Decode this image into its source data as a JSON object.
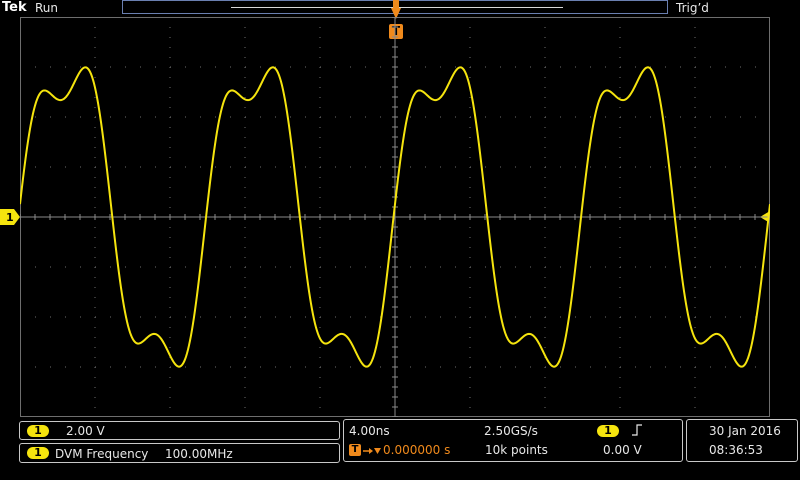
{
  "header": {
    "brand": "Tek",
    "acquisition_state": "Run",
    "trigger_state": "Trig’d"
  },
  "markers": {
    "trigger_marker": "T",
    "channel_marker": "1"
  },
  "channel1": {
    "label": "1",
    "vertical_scale": "2.00 V",
    "color": "#f5e40e"
  },
  "dvm": {
    "channel": "1",
    "label": "DVM Frequency",
    "value": "100.00MHz"
  },
  "horizontal": {
    "time_per_div": "4.00ns",
    "sample_rate": "2.50GS/s",
    "trigger_badge": "T",
    "delay": "0.000000 s",
    "record_length": "10k points"
  },
  "trigger": {
    "source": "1",
    "slope_icon": "rising-edge-icon",
    "level": "0.00 V",
    "color": "#f08a1c"
  },
  "datetime": {
    "date": "30 Jan  2016",
    "time": "08:36:53"
  },
  "waveform": {
    "frequency_mhz": 100,
    "harmonic3_ratio": 0.24,
    "harmonic3_phase": 0.35
  }
}
